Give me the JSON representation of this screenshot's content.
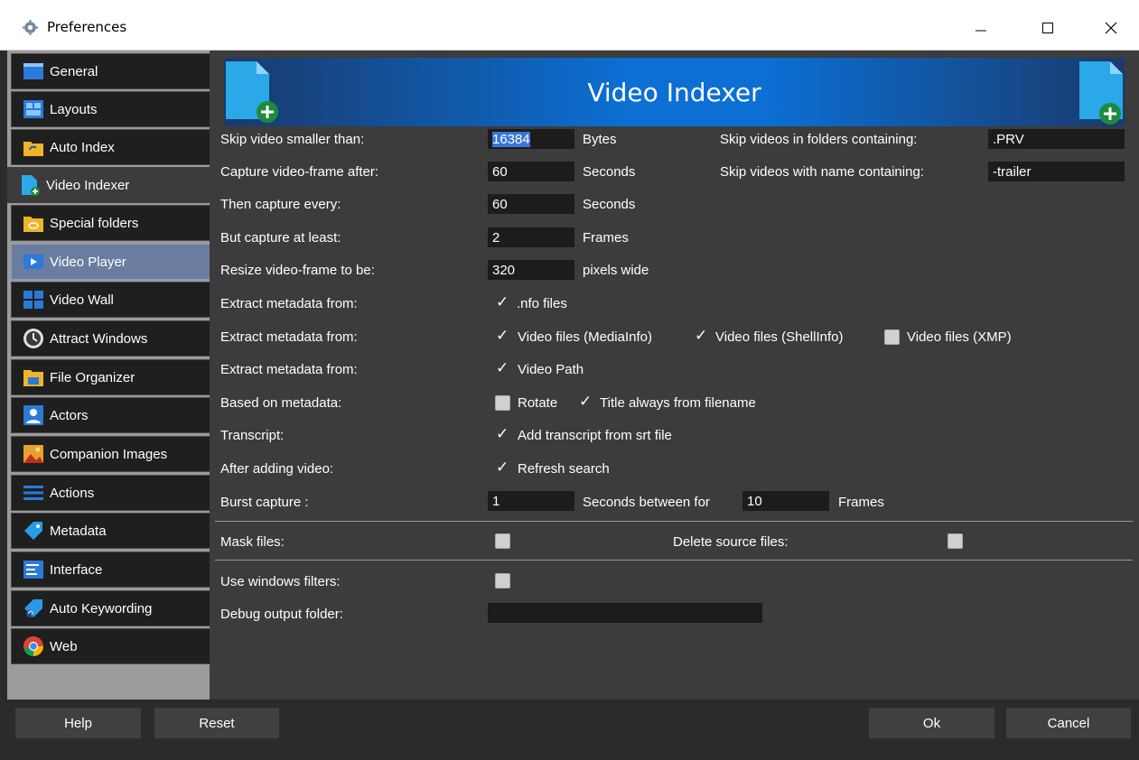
{
  "window": {
    "title": "Preferences"
  },
  "sidebar": {
    "items": [
      {
        "label": "General",
        "icon": "general-icon"
      },
      {
        "label": "Layouts",
        "icon": "layouts-icon"
      },
      {
        "label": "Auto Index",
        "icon": "auto-index-icon"
      },
      {
        "label": "Video Indexer",
        "icon": "video-indexer-icon"
      },
      {
        "label": "Special folders",
        "icon": "special-folders-icon"
      },
      {
        "label": "Video Player",
        "icon": "video-player-icon"
      },
      {
        "label": "Video Wall",
        "icon": "video-wall-icon"
      },
      {
        "label": "Attract Windows",
        "icon": "clock-icon"
      },
      {
        "label": "File Organizer",
        "icon": "file-organizer-icon"
      },
      {
        "label": "Actors",
        "icon": "actors-icon"
      },
      {
        "label": "Companion Images",
        "icon": "image-icon"
      },
      {
        "label": "Actions",
        "icon": "actions-icon"
      },
      {
        "label": "Metadata",
        "icon": "tag-icon"
      },
      {
        "label": "Interface",
        "icon": "interface-icon"
      },
      {
        "label": "Auto Keywording",
        "icon": "keyword-tag-icon"
      },
      {
        "label": "Web",
        "icon": "chrome-icon"
      }
    ]
  },
  "banner": {
    "title": "Video Indexer"
  },
  "form": {
    "skip_smaller_label": "Skip video smaller than:",
    "skip_smaller_value": "16384",
    "skip_smaller_unit": "Bytes",
    "capture_after_label": "Capture video-frame after:",
    "capture_after_value": "60",
    "capture_after_unit": "Seconds",
    "capture_every_label": "Then capture every:",
    "capture_every_value": "60",
    "capture_every_unit": "Seconds",
    "capture_least_label": "But capture at least:",
    "capture_least_value": "2",
    "capture_least_unit": "Frames",
    "resize_label": "Resize video-frame to be:",
    "resize_value": "320",
    "resize_unit": "pixels wide",
    "skip_folders_label": "Skip videos in folders containing:",
    "skip_folders_value": ".PRV",
    "skip_name_label": "Skip videos with name containing:",
    "skip_name_value": "-trailer",
    "extract1_label": "Extract metadata from:",
    "nfo_label": ".nfo files",
    "extract2_label": "Extract metadata from:",
    "mediainfo_label": "Video files (MediaInfo)",
    "shellinfo_label": "Video files (ShellInfo)",
    "xmp_label": "Video files (XMP)",
    "extract3_label": "Extract metadata from:",
    "videopath_label": "Video Path",
    "based_label": "Based on metadata:",
    "rotate_label": "Rotate",
    "title_filename_label": "Title always from filename",
    "transcript_label": "Transcript:",
    "add_transcript_label": "Add transcript from srt file",
    "after_adding_label": "After adding video:",
    "refresh_label": "Refresh search",
    "burst_label": "Burst capture :",
    "burst_value": "1",
    "burst_between_label": "Seconds between for",
    "burst_frames_value": "10",
    "burst_frames_unit": "Frames",
    "mask_label": "Mask files:",
    "delete_source_label": "Delete source files:",
    "windows_filters_label": "Use windows filters:",
    "debug_folder_label": "Debug output folder:",
    "debug_folder_value": ""
  },
  "footer": {
    "help": "Help",
    "reset": "Reset",
    "ok": "Ok",
    "cancel": "Cancel"
  },
  "colors": {
    "sidebar_active": "#6a7da0",
    "banner_blue": "#0b6fd4",
    "panel_bg": "#3c3c3c"
  }
}
